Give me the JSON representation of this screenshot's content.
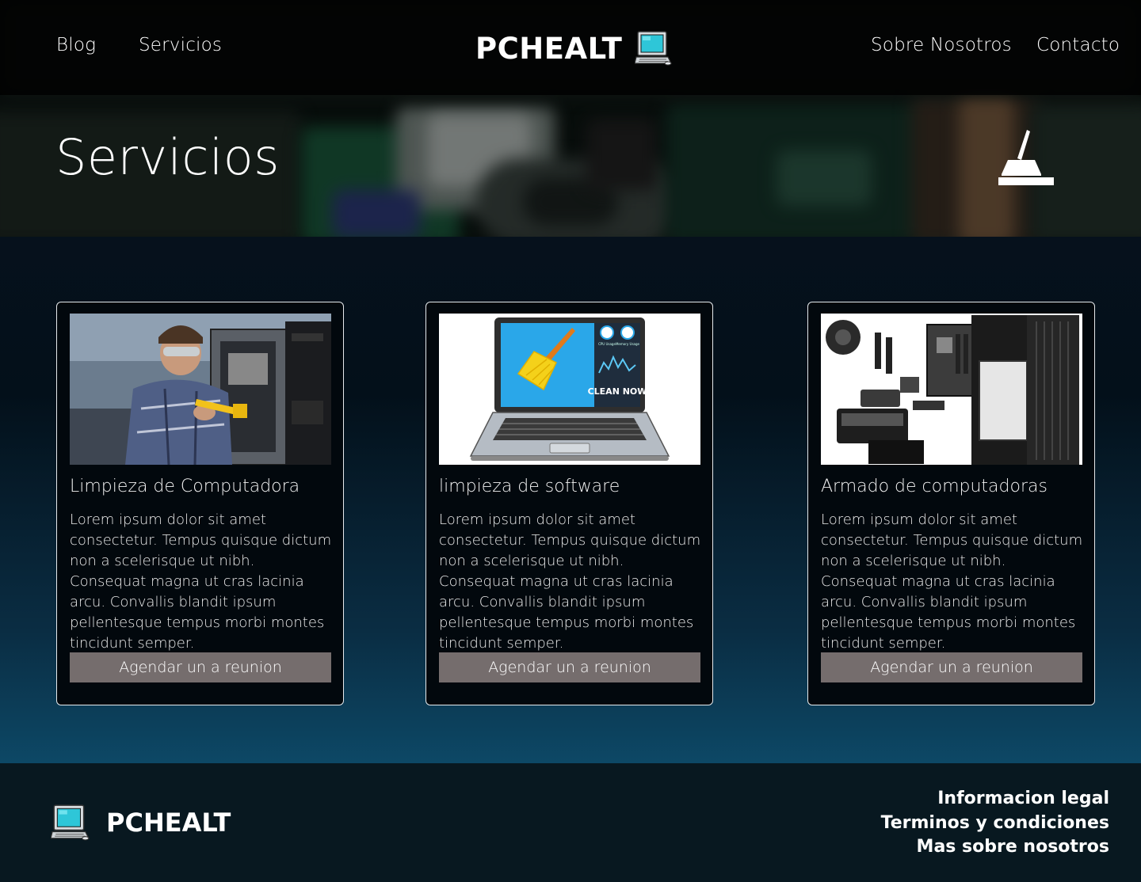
{
  "colors": {
    "nav_bg": "#000000",
    "main_gradient_top": "#06111c",
    "main_gradient_bottom": "#0d4866",
    "card_bg": "#02080d",
    "card_border": "#e6e9ec",
    "button_bg": "#756d6d",
    "footer_bg": "#081820"
  },
  "nav": {
    "left_links": [
      "Blog",
      "Servicios"
    ],
    "right_links": [
      "Sobre Nosotros",
      "Contacto"
    ],
    "brand": "PCHEALT",
    "brand_icon": "computer-icon"
  },
  "header": {
    "title": "Servicios",
    "icon": "broom-icon"
  },
  "cards": [
    {
      "title": "Limpieza de Computadora",
      "image": "technician-cleaning-pc-photo",
      "text": "Lorem ipsum dolor sit amet consectetur. Tempus quisque dictum non a scelerisque ut nibh. Consequat magna ut cras lacinia arcu. Convallis blandit ipsum pellentesque tempus morbi montes tincidunt semper.",
      "button": "Agendar un a reunion"
    },
    {
      "title": "limpieza de software",
      "image": "laptop-clean-now-illustration",
      "image_texts": {
        "cpu": "CPU Usage",
        "memory": "Memory Usage",
        "cta": "CLEAN NOW"
      },
      "text": "Lorem ipsum dolor sit amet consectetur. Tempus quisque dictum non a scelerisque ut nibh. Consequat magna ut cras lacinia arcu. Convallis blandit ipsum pellentesque tempus morbi montes tincidunt semper.",
      "button": "Agendar un a reunion"
    },
    {
      "title": "Armado de computadoras",
      "image": "pc-components-photo",
      "text": "Lorem ipsum dolor sit amet consectetur. Tempus quisque dictum non a scelerisque ut nibh. Consequat magna ut cras lacinia arcu. Convallis blandit ipsum pellentesque tempus morbi montes tincidunt semper.",
      "button": "Agendar un a reunion"
    }
  ],
  "footer": {
    "brand": "PCHEALT",
    "brand_icon": "computer-icon",
    "links": [
      "Informacion legal",
      "Terminos y condiciones",
      "Mas sobre nosotros"
    ]
  }
}
